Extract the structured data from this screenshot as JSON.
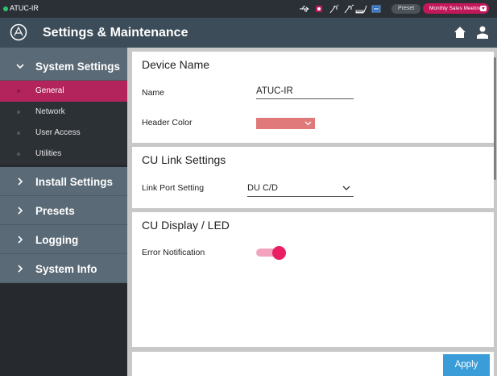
{
  "statusbar": {
    "device_name": "ATUC-IR",
    "connection_dot_color": "#2fc46b",
    "icons": [
      "usb-icon",
      "recording-icon",
      "mic-off-icon",
      "mic-on-icon",
      "cable-icon",
      "display-icon"
    ],
    "preset_label": "Preset",
    "preset_value": "Monthly Sales Meeting"
  },
  "header": {
    "title": "Settings & Maintenance",
    "icons": [
      "brand-logo-icon",
      "home-icon",
      "user-icon"
    ]
  },
  "sidebar": {
    "system_settings": {
      "label": "System Settings",
      "items": [
        {
          "label": "General",
          "active": true
        },
        {
          "label": "Network",
          "active": false
        },
        {
          "label": "User Access",
          "active": false
        },
        {
          "label": "Utilities",
          "active": false
        }
      ]
    },
    "groups": [
      {
        "label": "Install Settings"
      },
      {
        "label": "Presets"
      },
      {
        "label": "Logging"
      },
      {
        "label": "System Info"
      }
    ]
  },
  "main": {
    "device_name_section": {
      "title": "Device Name",
      "name_label": "Name",
      "name_value": "ATUC-IR",
      "header_color_label": "Header Color",
      "header_color_value": "#e07a7a"
    },
    "cu_link_section": {
      "title": "CU Link Settings",
      "link_port_label": "Link Port Setting",
      "link_port_value": "DU C/D"
    },
    "cu_display_section": {
      "title": "CU Display / LED",
      "error_notification_label": "Error Notification",
      "error_notification_on": true
    },
    "apply_label": "Apply"
  },
  "colors": {
    "accent": "#b3245c",
    "toggle_on": "#e91e63",
    "apply_button": "#3b9dd8",
    "header_bg": "#3c4c58"
  }
}
